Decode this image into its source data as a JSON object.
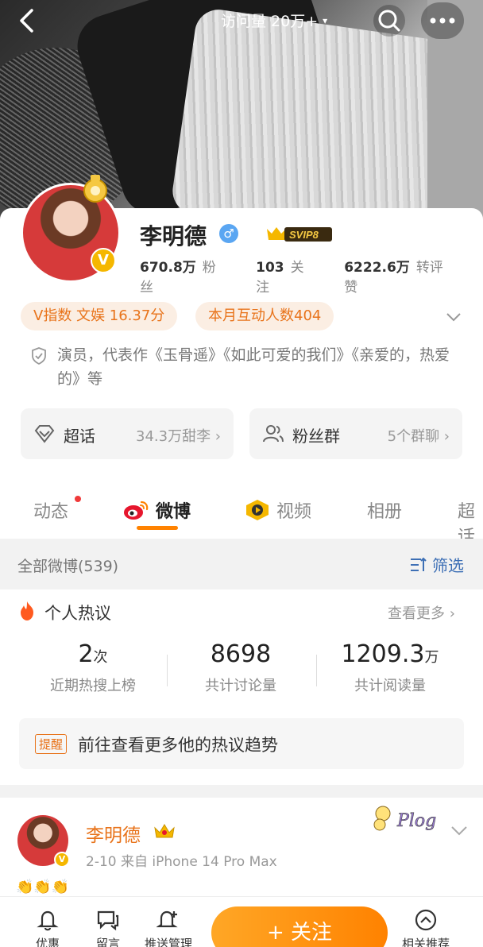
{
  "topbar": {
    "visits": "访问量 20万+",
    "caret": "▾"
  },
  "profile": {
    "name": "李明德",
    "gender": "♂",
    "svip": "SVIP8",
    "verified": "V",
    "stats": [
      {
        "value": "670.8万",
        "label": "粉丝"
      },
      {
        "value": "103",
        "label": "关注"
      },
      {
        "value": "6222.6万",
        "label": "转评赞"
      }
    ],
    "v_index": "V指数 文娱 16.37分",
    "interactions": "本月互动人数404",
    "bio": "演员，代表作《玉骨遥》《如此可爱的我们》《亲爱的，热爱的》等",
    "supertopic": {
      "label": "超话",
      "value": "34.3万甜李 ›"
    },
    "fans_group": {
      "label": "粉丝群",
      "value": "5个群聊 ›"
    }
  },
  "tabs": [
    {
      "label": "动态"
    },
    {
      "label": "微博"
    },
    {
      "label": "视频"
    },
    {
      "label": "相册"
    },
    {
      "label": "超话"
    }
  ],
  "filter": {
    "count": "全部微博(539)",
    "label": "筛选"
  },
  "hot": {
    "title": "个人热议",
    "more": "查看更多 ›",
    "metrics": [
      {
        "num": "2",
        "unit": "次",
        "label": "近期热搜上榜"
      },
      {
        "num": "8698",
        "unit": "",
        "label": "共计讨论量"
      },
      {
        "num": "1209.3",
        "unit": "万",
        "label": "共计阅读量"
      }
    ],
    "remind_tag": "提醒",
    "remind_text": "前往查看更多他的热议趋势"
  },
  "post": {
    "name": "李明德",
    "meta": "2-10  来自 iPhone 14 Pro Max",
    "sticker_text": "Plog",
    "emoji": "👏👏👏"
  },
  "bottombar": {
    "items": [
      {
        "label": "优惠"
      },
      {
        "label": "留言"
      },
      {
        "label": "推送管理"
      },
      {
        "label": "相关推荐"
      }
    ],
    "follow": "+ 关注"
  },
  "colors": {
    "accent": "#ff8200",
    "link": "#3d6fb5",
    "gender": "#5aa6f2"
  }
}
